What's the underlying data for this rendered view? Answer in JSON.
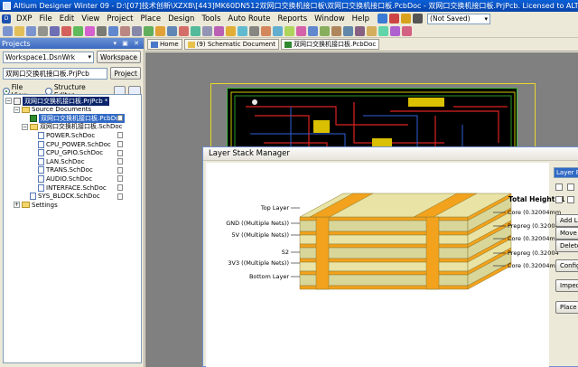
{
  "window": {
    "title": "Altium Designer Winter 09 - D:\\[07]技术创新\\XZXB\\[443]MK60DN512双网口交换机接口板\\双网口交换机接口板.PcbDoc - 双网口交换机接口板.PrjPcb. Licensed to ALTIUM. Not signed in."
  },
  "menu": {
    "logo": "DXP",
    "items": [
      "DXP",
      "File",
      "Edit",
      "View",
      "Project",
      "Place",
      "Design",
      "Tools",
      "Auto Route",
      "Reports",
      "Window",
      "Help"
    ],
    "save_state": "(Not Saved)"
  },
  "projects_panel": {
    "title": "Projects",
    "workspace_combo": "Workspace1.DsnWrk",
    "workspace_button": "Workspace",
    "project_name": "双网口交换机接口板.PrjPcb",
    "project_button": "Project",
    "view_file": "File View",
    "view_structure": "Structure Editor",
    "tree": [
      {
        "label": "双网口交换机接口板.PrjPcb *",
        "level": 0,
        "type": "project",
        "expander": "−",
        "style": "dark"
      },
      {
        "label": "Source Documents",
        "level": 1,
        "type": "folder",
        "expander": "−",
        "style": ""
      },
      {
        "label": "双网口交换机接口板.PcbDoc",
        "level": 2,
        "type": "pcb",
        "expander": "",
        "style": "blue"
      },
      {
        "label": "双网口交换机接口板.SchDoc",
        "level": 2,
        "type": "folder",
        "expander": "−",
        "style": ""
      },
      {
        "label": "POWER.SchDoc",
        "level": 3,
        "type": "doc",
        "expander": "",
        "style": ""
      },
      {
        "label": "CPU_POWER.SchDoc",
        "level": 3,
        "type": "doc",
        "expander": "",
        "style": ""
      },
      {
        "label": "CPU_GPIO.SchDoc",
        "level": 3,
        "type": "doc",
        "expander": "",
        "style": ""
      },
      {
        "label": "LAN.SchDoc",
        "level": 3,
        "type": "doc",
        "expander": "",
        "style": ""
      },
      {
        "label": "TRANS.SchDoc",
        "level": 3,
        "type": "doc",
        "expander": "",
        "style": ""
      },
      {
        "label": "AUDIO.SchDoc",
        "level": 3,
        "type": "doc",
        "expander": "",
        "style": ""
      },
      {
        "label": "INTERFACE.SchDoc",
        "level": 3,
        "type": "doc",
        "expander": "",
        "style": ""
      },
      {
        "label": "SYS_BLOCK.SchDoc",
        "level": 2,
        "type": "doc",
        "expander": "",
        "style": ""
      },
      {
        "label": "Settings",
        "level": 1,
        "type": "folder",
        "expander": "+",
        "style": ""
      }
    ]
  },
  "tabs": [
    {
      "label": "Home",
      "active": false
    },
    {
      "label": "(9) Schematic Document",
      "active": false
    },
    {
      "label": "双网口交换机接口板.PcbDoc",
      "active": true
    }
  ],
  "layer_stack_dialog": {
    "title": "Layer Stack Manager",
    "total_height": "Total Height (1",
    "layer_combo": "Layer Pa",
    "left_labels": [
      "Top Layer",
      "GND ((Multiple Nets))",
      "5V ((Multiple Nets))",
      "S2",
      "3V3 ((Multiple Nets))",
      "Bottom Layer"
    ],
    "right_labels": [
      "Core (0.32004mm",
      "Prepreg (0.32004",
      "Core (0.32004mm",
      "Prepreg (0.32004",
      "Core (0.32004mm"
    ],
    "buttons": [
      "Add Lay",
      "Move L",
      "Delete",
      "Config",
      "Impeda",
      "Place"
    ],
    "colors": {
      "prepreg": "#e9e4a6",
      "copper": "#f2a21c",
      "core": "#d9d69a"
    }
  }
}
